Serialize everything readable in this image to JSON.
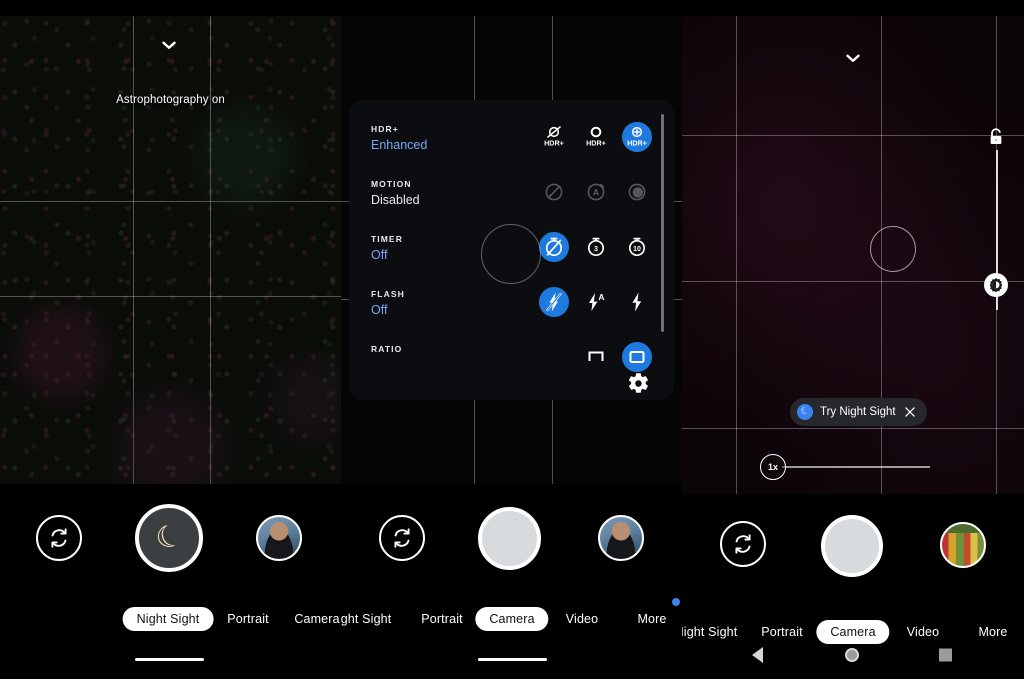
{
  "screenshot": {
    "app": "Google Camera",
    "panels": 3
  },
  "phone1": {
    "name": "night-sight-astrophotography",
    "top_chevron_icon": "chevron-down-icon",
    "status_text": "Astrophotography on",
    "flip_icon": "flip-camera-icon",
    "shutter_icon": "moon-icon",
    "shutter_glyph": "☾",
    "thumbnail": "person-photo-thumbnail",
    "modes": [
      {
        "label": "Night Sight",
        "selected": true
      },
      {
        "label": "Portrait",
        "selected": false
      },
      {
        "label": "Camera",
        "selected": false
      }
    ]
  },
  "phone2": {
    "name": "camera-settings-panel",
    "settings": {
      "rows": [
        {
          "label": "HDR+",
          "value": "Enhanced",
          "value_accent": true,
          "disabled": false,
          "options": [
            {
              "name": "hdr-off-icon",
              "selected": false
            },
            {
              "name": "hdr-on-icon",
              "selected": false
            },
            {
              "name": "hdr-enhanced-icon",
              "selected": true
            }
          ]
        },
        {
          "label": "MOTION",
          "value": "Disabled",
          "value_accent": false,
          "disabled": true,
          "options": [
            {
              "name": "motion-off-icon",
              "selected": false
            },
            {
              "name": "motion-auto-icon",
              "selected": false
            },
            {
              "name": "motion-on-icon",
              "selected": false
            }
          ]
        },
        {
          "label": "TIMER",
          "value": "Off",
          "value_accent": true,
          "disabled": false,
          "options": [
            {
              "name": "timer-off-icon",
              "selected": true
            },
            {
              "name": "timer-3s-icon",
              "selected": false,
              "text": "3"
            },
            {
              "name": "timer-10s-icon",
              "selected": false,
              "text": "10"
            }
          ]
        },
        {
          "label": "FLASH",
          "value": "Off",
          "value_accent": true,
          "disabled": false,
          "options": [
            {
              "name": "flash-off-icon",
              "selected": true
            },
            {
              "name": "flash-auto-icon",
              "selected": false
            },
            {
              "name": "flash-on-icon",
              "selected": false
            }
          ]
        },
        {
          "label": "RATIO",
          "value": "",
          "value_accent": false,
          "disabled": false,
          "options": [
            {
              "name": "ratio-16-9-icon",
              "selected": false
            },
            {
              "name": "ratio-4-3-icon",
              "selected": true
            }
          ]
        }
      ],
      "more_settings_icon": "gear-icon"
    },
    "flip_icon": "flip-camera-icon",
    "shutter_icon": "shutter-button",
    "thumbnail": "person-photo-thumbnail",
    "modes": [
      {
        "label": "Night Sight",
        "selected": false
      },
      {
        "label": "Portrait",
        "selected": false
      },
      {
        "label": "Camera",
        "selected": true
      },
      {
        "label": "Video",
        "selected": false
      },
      {
        "label": "More",
        "selected": false,
        "badge": true
      }
    ]
  },
  "phone3": {
    "name": "camera-try-night-sight",
    "top_chevron_icon": "chevron-down-icon",
    "lock_icon": "ae-af-lock-icon",
    "exposure_icon": "brightness-icon",
    "focus_ring_icon": "focus-ring",
    "suggestion": {
      "icon": "moon-icon",
      "glyph": "☾",
      "text": "Try Night Sight",
      "close_icon": "close-icon"
    },
    "zoom": {
      "label": "1x"
    },
    "flip_icon": "flip-camera-icon",
    "shutter_icon": "shutter-button",
    "thumbnail": "market-photo-thumbnail",
    "modes": [
      {
        "label": "Night Sight",
        "selected": false
      },
      {
        "label": "Portrait",
        "selected": false
      },
      {
        "label": "Camera",
        "selected": true
      },
      {
        "label": "Video",
        "selected": false
      },
      {
        "label": "More",
        "selected": false
      }
    ],
    "navbar": {
      "back_icon": "back-triangle-icon",
      "home_icon": "home-circle-icon",
      "recents_icon": "recents-square-icon"
    }
  },
  "colors": {
    "accent_blue": "#1f7ae0",
    "accent_text": "#7aa7f5",
    "panel_bg": "#0c0d10",
    "chip_bg": "#26282c",
    "shutter_fill": "#d7dbdd"
  }
}
